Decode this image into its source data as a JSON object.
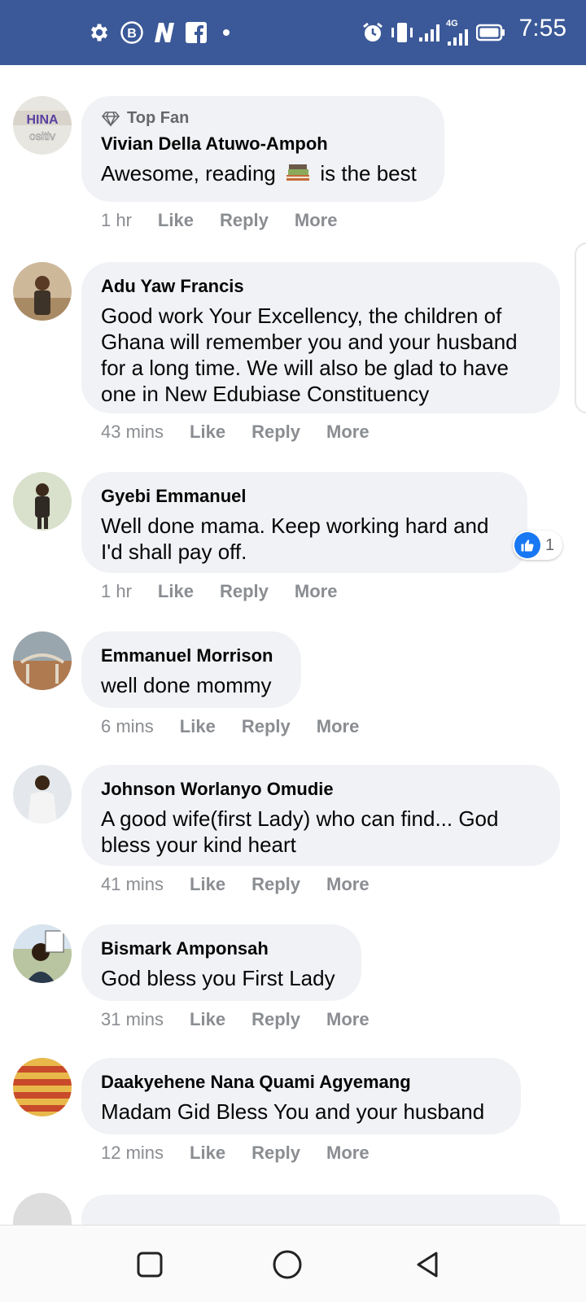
{
  "status_bar": {
    "time": "7:55",
    "left_icons": [
      "gear-icon",
      "b-icon",
      "n-icon",
      "facebook-icon",
      "dot-icon"
    ],
    "right_icons": [
      "alarm-icon",
      "vibrate-icon",
      "signal-icon",
      "4g-signal-icon",
      "battery-icon"
    ],
    "network_label": "4G",
    "color": "#3b5998"
  },
  "comments": [
    {
      "badge": "Top Fan",
      "author": "Vivian Della Atuwo-Ampoh",
      "text_before": "Awesome, reading",
      "emoji": "books-emoji",
      "text_after": "is the best",
      "time": "1 hr",
      "like": "Like",
      "reply": "Reply",
      "more": "More"
    },
    {
      "author": "Adu Yaw Francis",
      "text": "Good work Your Excellency, the children of Ghana will remember you and your husband for a long time. We will also be glad to have one in New Edubiase Constituency",
      "time": "43 mins",
      "like": "Like",
      "reply": "Reply",
      "more": "More"
    },
    {
      "author": "Gyebi Emmanuel",
      "text": "Well done mama. Keep working hard and I'd shall pay off.",
      "time": "1 hr",
      "like": "Like",
      "reply": "Reply",
      "more": "More",
      "reaction_count": "1"
    },
    {
      "author": "Emmanuel Morrison",
      "text": "well done mommy",
      "time": "6 mins",
      "like": "Like",
      "reply": "Reply",
      "more": "More"
    },
    {
      "author": "Johnson Worlanyo Omudie",
      "text": "A good wife(first Lady) who can find... God bless your kind heart",
      "time": "41 mins",
      "like": "Like",
      "reply": "Reply",
      "more": "More"
    },
    {
      "author": "Bismark Amponsah",
      "text": "God bless you First Lady",
      "time": "31 mins",
      "like": "Like",
      "reply": "Reply",
      "more": "More"
    },
    {
      "author": "Daakyehene Nana Quami Agyemang",
      "text": "Madam Gid Bless You and your husband",
      "time": "12 mins",
      "like": "Like",
      "reply": "Reply",
      "more": "More"
    }
  ],
  "nav_bar": {
    "buttons": [
      "recents-square-icon",
      "home-circle-icon",
      "back-triangle-icon"
    ]
  }
}
